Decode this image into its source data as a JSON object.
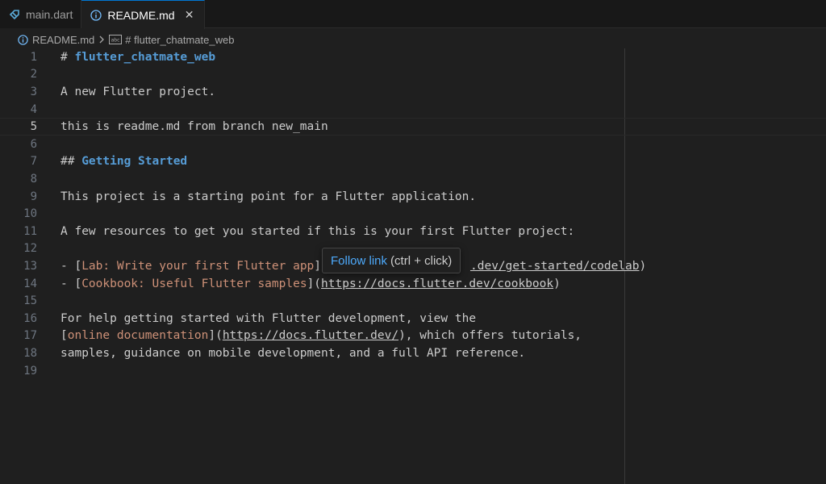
{
  "tabs": [
    {
      "label": "main.dart",
      "icon": "dart-file-icon",
      "active": false
    },
    {
      "label": "README.md",
      "icon": "info-icon",
      "active": true,
      "close": "✕"
    }
  ],
  "breadcrumb": {
    "file": "README.md",
    "symbol": "# flutter_chatmate_web"
  },
  "lines": {
    "n1": "1",
    "n2": "2",
    "n3": "3",
    "n4": "4",
    "n5": "5",
    "n6": "6",
    "n7": "7",
    "n8": "8",
    "n9": "9",
    "n10": "10",
    "n11": "11",
    "n12": "12",
    "n13": "13",
    "n14": "14",
    "n15": "15",
    "n16": "16",
    "n17": "17",
    "n18": "18",
    "n19": "19",
    "l1_mark": "# ",
    "l1_text": "flutter_chatmate_web",
    "l3": "A new Flutter project.",
    "l5": "this is readme.md from branch new_main",
    "l7_mark": "## ",
    "l7_text": "Getting Started",
    "l9": "This project is a starting point for a Flutter application.",
    "l11": "A few resources to get you started if this is your first Flutter project:",
    "l13_dash": "- [",
    "l13_text": "Lab: Write your first Flutter app",
    "l13_close": "]",
    "l13_url": ".dev/get-started/codelab",
    "l13_end": ")",
    "l14_dash": "- [",
    "l14_text": "Cookbook: Useful Flutter samples",
    "l14_mid": "](",
    "l14_url": "https://docs.flutter.dev/cookbook",
    "l14_end": ")",
    "l16": "For help getting started with Flutter development, view the",
    "l17_open": "[",
    "l17_text": "online documentation",
    "l17_mid": "](",
    "l17_url": "https://docs.flutter.dev/",
    "l17_end": "), which offers tutorials,",
    "l18": "samples, guidance on mobile development, and a full API reference."
  },
  "hover": {
    "follow": "Follow link",
    "keys": "(ctrl + click)"
  },
  "colors": {
    "accent": "#0078d4",
    "header": "#569cd6",
    "link_text": "#ce9178",
    "follow_link": "#4daafc"
  }
}
